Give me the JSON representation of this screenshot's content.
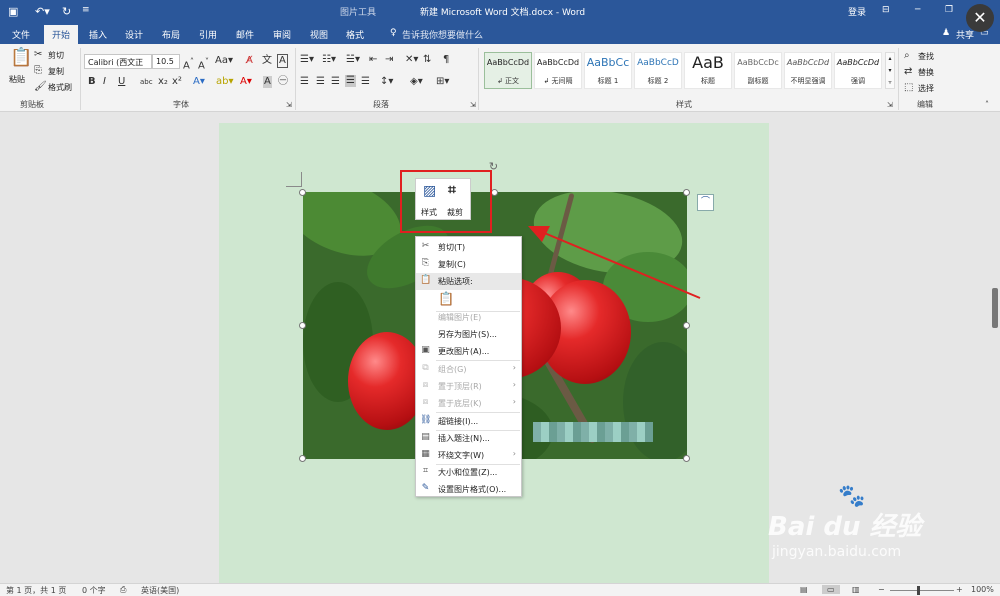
{
  "titlebar": {
    "doc_title": "新建 Microsoft Word 文档.docx - Word",
    "context_tab_group": "图片工具",
    "login": "登录"
  },
  "tabs": [
    "文件",
    "开始",
    "插入",
    "设计",
    "布局",
    "引用",
    "邮件",
    "审阅",
    "视图",
    "格式"
  ],
  "tell_me": "告诉我你想要做什么",
  "share": "共享",
  "ribbon": {
    "clipboard": {
      "paste": "粘贴",
      "cut": "剪切",
      "copy": "复制",
      "format_painter": "格式刷",
      "label": "剪贴板"
    },
    "font": {
      "name": "Calibri (西文正",
      "size": "10.5",
      "label": "字体"
    },
    "paragraph": {
      "label": "段落"
    },
    "styles": {
      "label": "样式",
      "items": [
        {
          "preview": "AaBbCcDd",
          "name": "↲ 正文"
        },
        {
          "preview": "AaBbCcDd",
          "name": "↲ 无间隔"
        },
        {
          "preview": "AaBbCc",
          "name": "标题 1"
        },
        {
          "preview": "AaBbCcD",
          "name": "标题 2"
        },
        {
          "preview": "AaB",
          "name": "标题"
        },
        {
          "preview": "AaBbCcDc",
          "name": "副标题"
        },
        {
          "preview": "AaBbCcDd",
          "name": "不明显强调"
        },
        {
          "preview": "AaBbCcDd",
          "name": "强调"
        }
      ]
    },
    "editing": {
      "find": "查找",
      "replace": "替换",
      "select": "选择",
      "label": "编辑"
    }
  },
  "float_toolbar": {
    "style": "样式",
    "crop": "裁剪"
  },
  "context_menu": [
    {
      "icon": "cut-icon",
      "label": "剪切(T)",
      "enabled": true
    },
    {
      "icon": "copy-icon",
      "label": "复制(C)",
      "enabled": true
    },
    {
      "icon": "paste-icon",
      "label": "粘贴选项:",
      "enabled": true,
      "header": true
    },
    {
      "icon": "",
      "label": "编辑图片(E)",
      "enabled": false
    },
    {
      "icon": "",
      "label": "另存为图片(S)...",
      "enabled": true
    },
    {
      "icon": "change-picture-icon",
      "label": "更改图片(A)...",
      "enabled": true
    },
    {
      "icon": "group-icon",
      "label": "组合(G)",
      "enabled": false,
      "submenu": true
    },
    {
      "icon": "bring-front-icon",
      "label": "置于顶层(R)",
      "enabled": false,
      "submenu": true
    },
    {
      "icon": "send-back-icon",
      "label": "置于底层(K)",
      "enabled": false,
      "submenu": true
    },
    {
      "icon": "hyperlink-icon",
      "label": "超链接(I)...",
      "enabled": true
    },
    {
      "icon": "caption-icon",
      "label": "插入题注(N)...",
      "enabled": true
    },
    {
      "icon": "wrap-text-icon",
      "label": "环绕文字(W)",
      "enabled": true,
      "submenu": true
    },
    {
      "icon": "size-icon",
      "label": "大小和位置(Z)...",
      "enabled": true
    },
    {
      "icon": "format-picture-icon",
      "label": "设置图片格式(O)...",
      "enabled": true
    }
  ],
  "status": {
    "page": "第 1 页，共 1 页",
    "words": "0 个字",
    "language": "英语(美国)",
    "zoom": "100%"
  },
  "watermark": {
    "brand": "Bai du 经验",
    "url": "jingyan.baidu.com"
  },
  "colors": {
    "accent": "#2b579a",
    "highlight": "#e02020",
    "page_bg": "#cfe7d0"
  }
}
